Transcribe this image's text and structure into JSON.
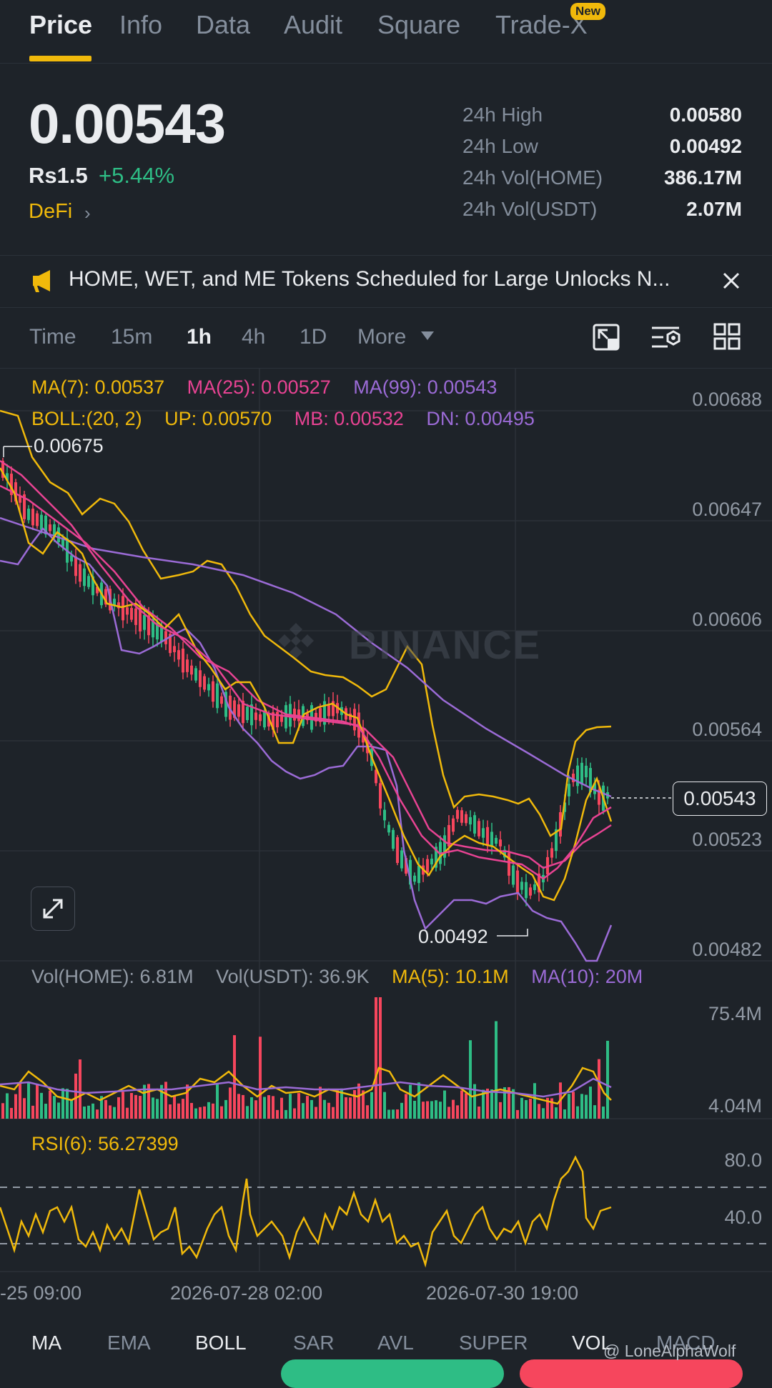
{
  "tabs": [
    "Price",
    "Info",
    "Data",
    "Audit",
    "Square",
    "Trade-X"
  ],
  "new_badge": "New",
  "price": {
    "last": "0.00543",
    "fiat": "Rs1.5",
    "change": "+5.44%",
    "category": "DeFi"
  },
  "stats": [
    {
      "label": "24h High",
      "value": "0.00580"
    },
    {
      "label": "24h Low",
      "value": "0.00492"
    },
    {
      "label": "24h Vol(HOME)",
      "value": "386.17M"
    },
    {
      "label": "24h Vol(USDT)",
      "value": "2.07M"
    }
  ],
  "news": "HOME, WET, and ME Tokens Scheduled for Large Unlocks N...",
  "timeframes": [
    "Time",
    "15m",
    "1h",
    "4h",
    "1D",
    "More"
  ],
  "active_timeframe": "1h",
  "indicators": {
    "ma7": "MA(7): 0.00537",
    "ma25": "MA(25): 0.00527",
    "ma99": "MA(99): 0.00543",
    "boll": "BOLL:(20, 2)",
    "up": "UP: 0.00570",
    "mb": "MB: 0.00532",
    "dn": "DN: 0.00495"
  },
  "price_axis": [
    "0.00688",
    "0.00647",
    "0.00606",
    "0.00564",
    "0.00523",
    "0.00482"
  ],
  "high_marker": "0.00675",
  "low_marker": "0.00492",
  "current_price_tag": "0.00543",
  "watermark": "BINANCE",
  "volume": {
    "vol_home": "Vol(HOME): 6.81M",
    "vol_usdt": "Vol(USDT): 36.9K",
    "ma5": "MA(5): 10.1M",
    "ma10": "MA(10): 20M",
    "axis_top": "75.4M",
    "axis_bottom": "4.04M"
  },
  "rsi": {
    "label": "RSI(6): 56.27399",
    "axis": [
      "80.0",
      "40.0"
    ]
  },
  "x_axis": [
    "-25 09:00",
    "2026-07-28 02:00",
    "2026-07-30 19:00"
  ],
  "bottom_tabs": [
    "MA",
    "EMA",
    "BOLL",
    "SAR",
    "AVL",
    "SUPER",
    "VOL",
    "MACD"
  ],
  "credit": "@ LoneAlphaWolf",
  "colors": {
    "bg": "#1e2329",
    "up": "#2ebd85",
    "down": "#f6465d",
    "accent": "#f0b90b",
    "ma7": "#f0b90b",
    "ma25": "#e84393",
    "ma99": "#9b6bd6"
  }
}
